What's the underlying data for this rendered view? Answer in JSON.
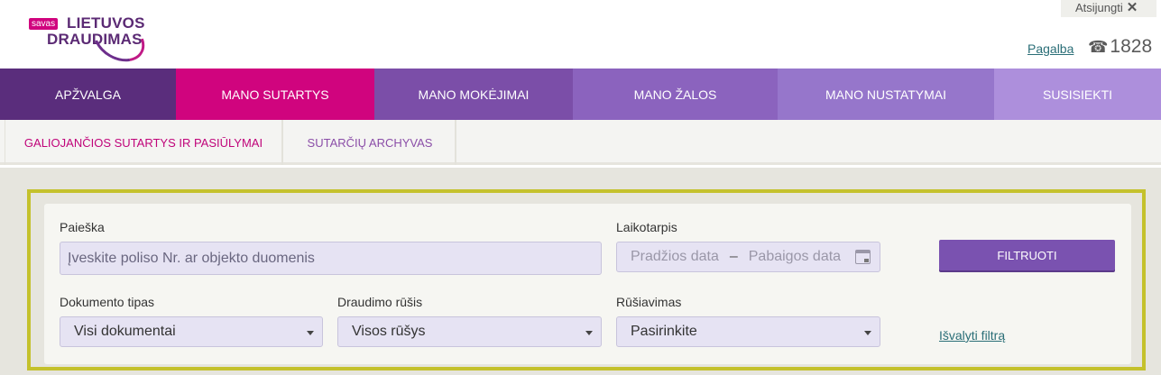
{
  "header": {
    "logo_badge": "savas",
    "logo_line1": "LIETUVOS",
    "logo_line2": "DRAUDIMAS",
    "logout_label": "Atsijungti",
    "logout_x": "✕",
    "help_label": "Pagalba",
    "phone_number": "1828"
  },
  "main_nav": {
    "tabs": [
      {
        "label": "APŽVALGA"
      },
      {
        "label": "MANO SUTARTYS"
      },
      {
        "label": "MANO MOKĖJIMAI"
      },
      {
        "label": "MANO ŽALOS"
      },
      {
        "label": "MANO NUSTATYMAI"
      },
      {
        "label": "SUSISIEKTI"
      }
    ],
    "active": "MANO SUTARTYS"
  },
  "sub_nav": {
    "tabs": [
      {
        "label": "GALIOJANČIOS SUTARTYS IR PASIŪLYMAI"
      },
      {
        "label": "SUTARČIŲ ARCHYVAS"
      }
    ]
  },
  "filter": {
    "search_label": "Paieška",
    "search_placeholder": "Įveskite poliso Nr. ar objekto duomenis",
    "period_label": "Laikotarpis",
    "date_from_placeholder": "Pradžios data",
    "date_sep": "–",
    "date_to_placeholder": "Pabaigos data",
    "filter_button": "FILTRUOTI",
    "doc_type_label": "Dokumento tipas",
    "doc_type_value": "Visi dokumentai",
    "insurance_type_label": "Draudimo rūšis",
    "insurance_type_value": "Visos rūšys",
    "sort_label": "Rūšiavimas",
    "sort_value": "Pasirinkite",
    "clear_link": "Išvalyti filtrą"
  },
  "colors": {
    "brand_purple": "#5a2d7c",
    "brand_magenta": "#d0047e",
    "frame_highlight": "#c4c12c",
    "link": "#2a6e77"
  }
}
